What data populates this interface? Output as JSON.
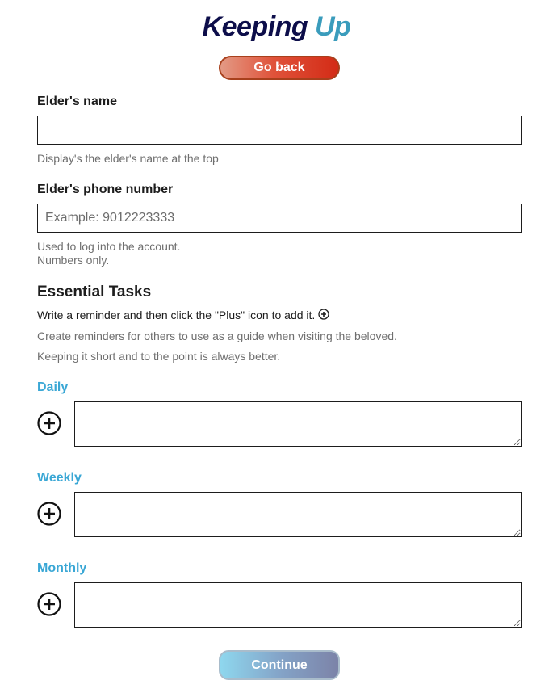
{
  "header": {
    "logo_part1": "Keeping",
    "logo_part2": "Up",
    "go_back_label": "Go back"
  },
  "elder_name": {
    "label": "Elder's name",
    "value": "",
    "placeholder": "",
    "help": "Display's the elder's name at the top"
  },
  "elder_phone": {
    "label": "Elder's phone number",
    "value": "",
    "placeholder": "Example: 9012223333",
    "help_line1": "Used to log into the account.",
    "help_line2": "Numbers only."
  },
  "essential_tasks": {
    "title": "Essential Tasks",
    "instruction": "Write a reminder and then click the \"Plus\" icon to add it.",
    "help_line1": "Create reminders for others to use as a guide when visiting the beloved.",
    "help_line2": "Keeping it short and to the point is always better."
  },
  "categories": [
    {
      "label": "Daily",
      "value": ""
    },
    {
      "label": "Weekly",
      "value": ""
    },
    {
      "label": "Monthly",
      "value": ""
    }
  ],
  "footer": {
    "continue_label": "Continue"
  },
  "colors": {
    "logo_dark": "#0d0e4a",
    "logo_light": "#3a9cbc",
    "go_back": "#d32b16",
    "category": "#3aa7d5",
    "continue": "#84a4c8"
  },
  "icons": {
    "add_task": "plus-circle-icon"
  }
}
